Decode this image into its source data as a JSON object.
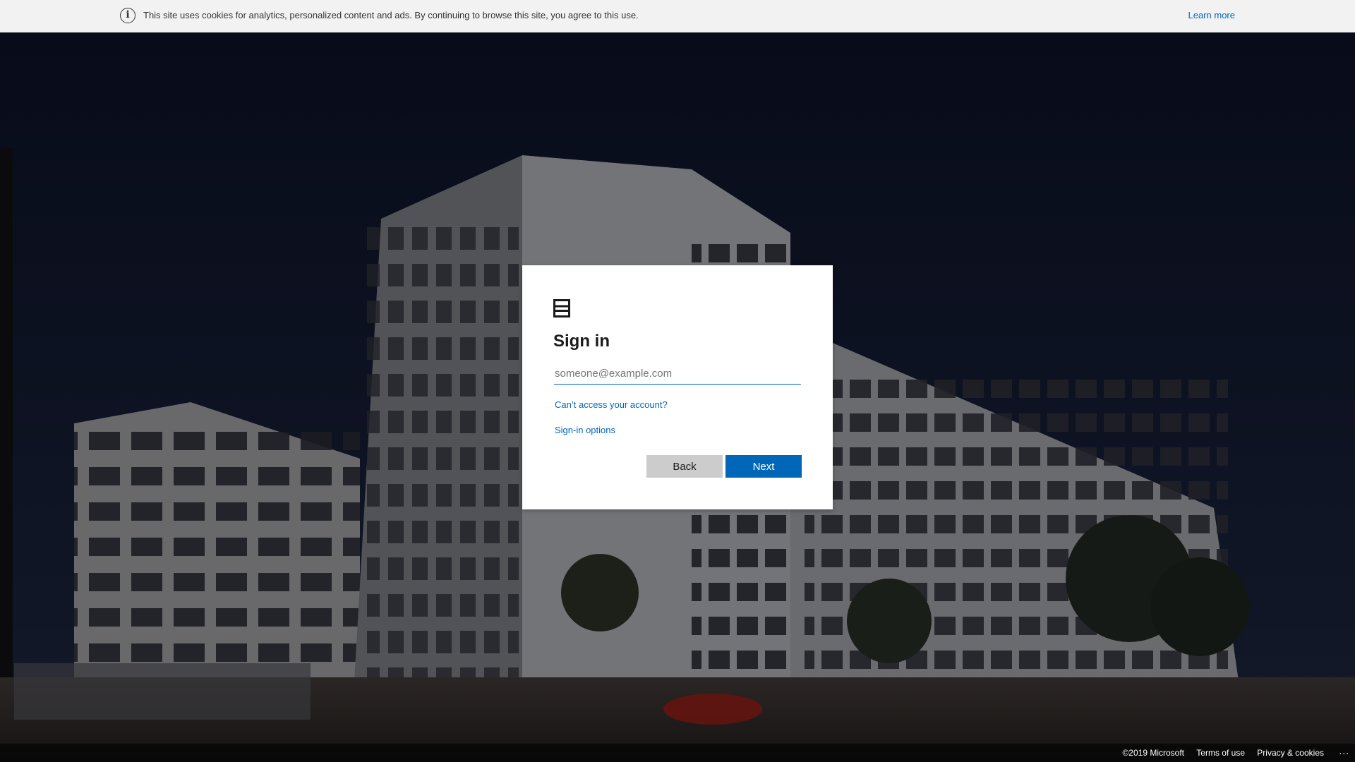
{
  "cookie_banner": {
    "icon": "info-icon",
    "text": "This site uses cookies for analytics, personalized content and ads. By continuing to browse this site, you agree to this use.",
    "learn_more": "Learn more"
  },
  "card": {
    "logo_icon": "organization-logo-icon",
    "title": "Sign in",
    "email_placeholder": "someone@example.com",
    "email_value": "",
    "cant_access_link": "Can’t access your account?",
    "signin_options_link": "Sign-in options",
    "back_label": "Back",
    "next_label": "Next"
  },
  "footer": {
    "copyright": "©2019 Microsoft",
    "terms": "Terms of use",
    "privacy": "Privacy & cookies",
    "more": "..."
  },
  "colors": {
    "accent": "#0067b8",
    "banner_bg": "#f2f2f2",
    "back_button_bg": "#cccccc",
    "card_bg": "#ffffff"
  }
}
